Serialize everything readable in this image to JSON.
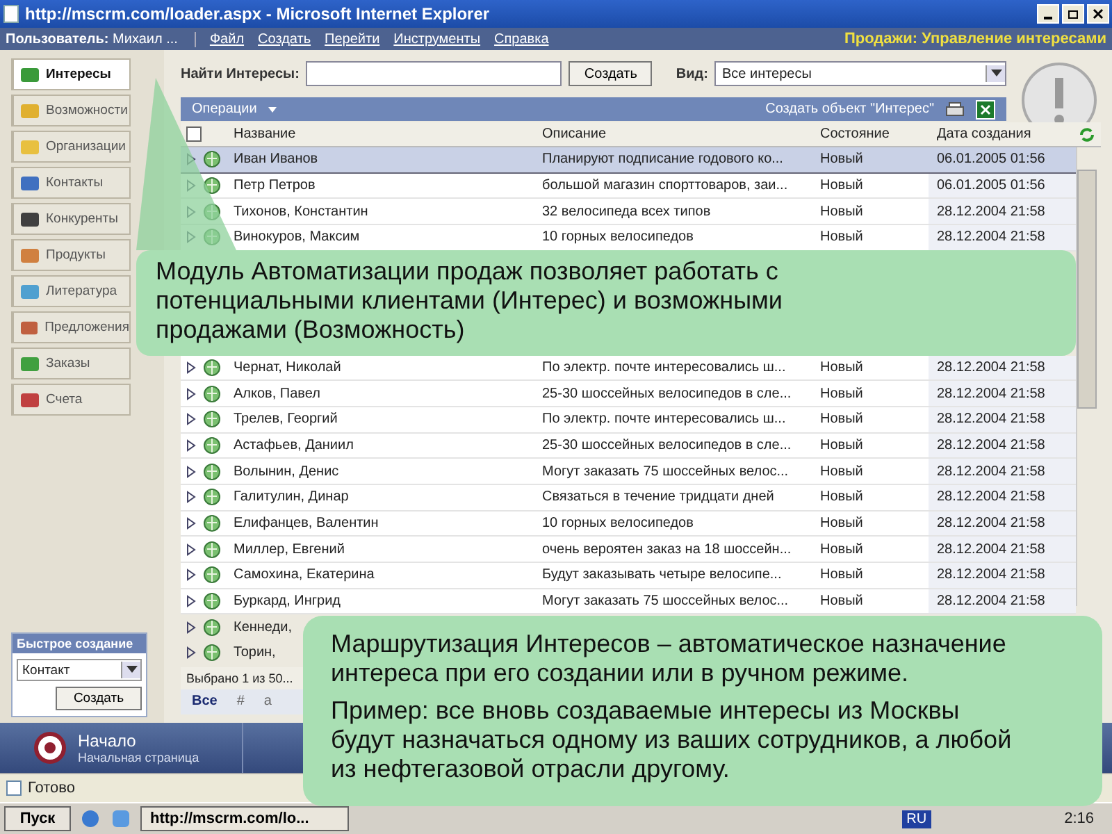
{
  "window": {
    "title": "http://mscrm.com/loader.aspx - Microsoft Internet Explorer"
  },
  "menu_bar": {
    "user_label": "Пользователь:",
    "user_name": "Михаил ...",
    "items": [
      "Файл",
      "Создать",
      "Перейти",
      "Инструменты",
      "Справка"
    ],
    "page_title": "Продажи: Управление интересами"
  },
  "sidebar": {
    "items": [
      {
        "label": "Интересы",
        "selected": true
      },
      {
        "label": "Возможности",
        "selected": false
      },
      {
        "label": "Организации",
        "selected": false
      },
      {
        "label": "Контакты",
        "selected": false
      },
      {
        "label": "Конкуренты",
        "selected": false
      },
      {
        "label": "Продукты",
        "selected": false
      },
      {
        "label": "Литература",
        "selected": false
      },
      {
        "label": "Предложения",
        "selected": false
      },
      {
        "label": "Заказы",
        "selected": false
      },
      {
        "label": "Счета",
        "selected": false
      }
    ],
    "quick_create": {
      "title": "Быстрое создание",
      "type_value": "Контакт",
      "button": "Создать"
    }
  },
  "toolbar": {
    "search_label": "Найти Интересы:",
    "create_button": "Создать",
    "view_label": "Вид:",
    "view_value": "Все интересы"
  },
  "operations_bar": {
    "menu": "Операции",
    "create_object": "Создать объект \"Интерес\""
  },
  "table": {
    "select_all_checked": false,
    "columns": [
      "Название",
      "Описание",
      "Состояние",
      "Дата создания"
    ],
    "rows": [
      {
        "name": "Иван Иванов",
        "description": "Планируют подписание годового ко...",
        "status": "Новый",
        "date": "06.01.2005 01:56",
        "selected": true
      },
      {
        "name": "Петр Петров",
        "description": "большой магазин спорттоваров, заи...",
        "status": "Новый",
        "date": "06.01.2005 01:56",
        "selected": false
      },
      {
        "name": "Тихонов, Константин",
        "description": "32 велосипеда всех типов",
        "status": "Новый",
        "date": "28.12.2004 21:58",
        "selected": false
      },
      {
        "name": "Винокуров, Максим",
        "description": "10 горных велосипедов",
        "status": "Новый",
        "date": "28.12.2004 21:58",
        "selected": false
      },
      {
        "name": "Чернат, Николай",
        "description": "По электр. почте интересовались ш...",
        "status": "Новый",
        "date": "28.12.2004 21:58",
        "selected": false
      },
      {
        "name": "Алков, Павел",
        "description": "25-30 шоссейных велосипедов в сле...",
        "status": "Новый",
        "date": "28.12.2004 21:58",
        "selected": false
      },
      {
        "name": "Трелев, Георгий",
        "description": "По электр. почте интересовались ш...",
        "status": "Новый",
        "date": "28.12.2004 21:58",
        "selected": false
      },
      {
        "name": "Астафьев, Даниил",
        "description": "25-30 шоссейных велосипедов в сле...",
        "status": "Новый",
        "date": "28.12.2004 21:58",
        "selected": false
      },
      {
        "name": "Волынин, Денис",
        "description": "Могут заказать 75 шоссейных велос...",
        "status": "Новый",
        "date": "28.12.2004 21:58",
        "selected": false
      },
      {
        "name": "Галитулин, Динар",
        "description": "Связаться в течение тридцати дней",
        "status": "Новый",
        "date": "28.12.2004 21:58",
        "selected": false
      },
      {
        "name": "Елифанцев, Валентин",
        "description": "10 горных велосипедов",
        "status": "Новый",
        "date": "28.12.2004 21:58",
        "selected": false
      },
      {
        "name": "Миллер, Евгений",
        "description": "очень вероятен заказ на 18 шоссейн...",
        "status": "Новый",
        "date": "28.12.2004 21:58",
        "selected": false
      },
      {
        "name": "Самохина, Екатерина",
        "description": "Будут заказывать четыре велосипе...",
        "status": "Новый",
        "date": "28.12.2004 21:58",
        "selected": false
      },
      {
        "name": "Буркард, Ингрид",
        "description": "Могут заказать 75 шоссейных велос...",
        "status": "Новый",
        "date": "28.12.2004 21:58",
        "selected": false
      },
      {
        "name": "Кеннеди,"
      },
      {
        "name": "Торин,"
      }
    ],
    "selection_status": "Выбрано 1 из 50...",
    "alphabet": [
      "Все",
      "#",
      "а"
    ]
  },
  "nav_tabs": [
    {
      "title": "Начало",
      "subtitle": "Начальная страница"
    }
  ],
  "status_bar": {
    "text": "Готово"
  },
  "taskbar": {
    "start": "Пуск",
    "task": "http://mscrm.com/lo...",
    "language": "RU",
    "clock": "2:16"
  },
  "callouts": [
    {
      "paragraphs": [
        "Модуль Автоматизации продаж позволяет работать с потенциальными клиентами (Интерес) и возможными продажами (Возможность)"
      ]
    },
    {
      "paragraphs": [
        "Маршрутизация Интересов – автоматическое назначение интереса при его создании или в ручном режиме.",
        "Пример: все вновь создаваемые интересы из Москвы будут назначаться одному из ваших сотрудников, а любой из нефтегазовой отрасли другому."
      ]
    }
  ]
}
